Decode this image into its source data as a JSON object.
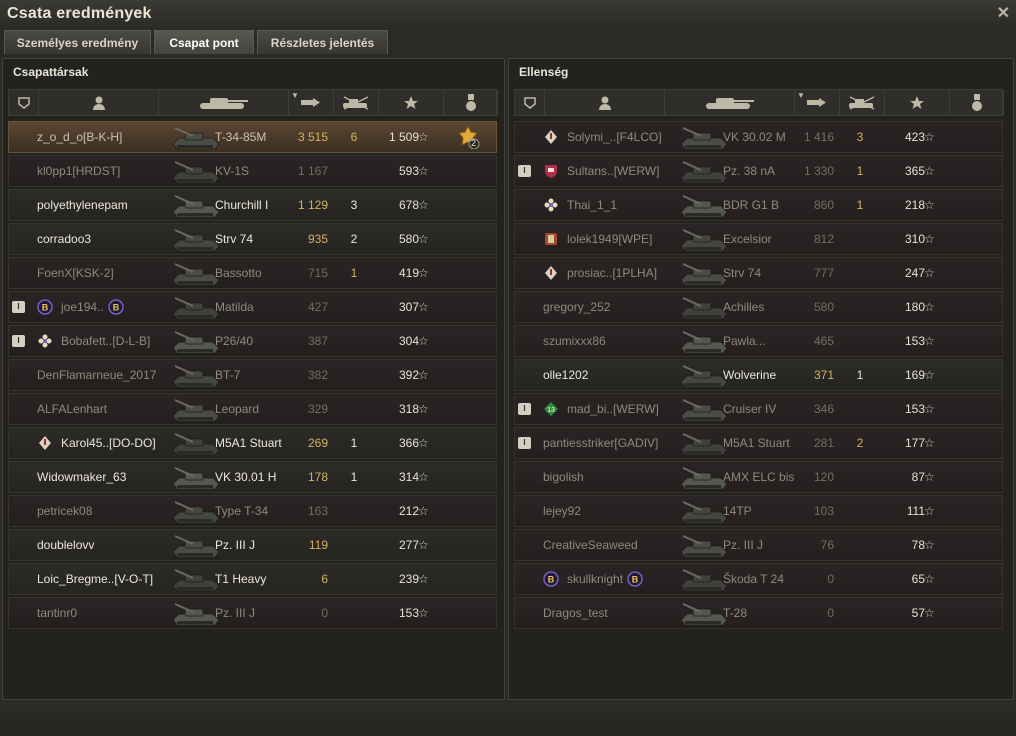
{
  "window": {
    "title": "Csata eredmények",
    "close_icon": "close-icon"
  },
  "tabs": [
    {
      "label": "Személyes eredmény",
      "active": false
    },
    {
      "label": "Csapat pont",
      "active": true
    },
    {
      "label": "Részletes jelentés",
      "active": false
    }
  ],
  "allies": {
    "title": "Csapattársak",
    "players": [
      {
        "name": "z_o_d_o[B-K-H]",
        "tank": "T-34-85M",
        "damage": "3 515",
        "kills": "6",
        "xp": "1 509",
        "state": "sel",
        "medal": {
          "count": "2"
        }
      },
      {
        "name": "kl0pp1[HRDST]",
        "tank": "KV-1S",
        "damage": "1 167",
        "kills": "",
        "xp": "593",
        "state": "dead"
      },
      {
        "name": "polyethylenepam",
        "tank": "Churchill I",
        "damage": "1 129",
        "kills": "3",
        "xp": "678",
        "state": "alive"
      },
      {
        "name": "corradoo3",
        "tank": "Strv 74",
        "damage": "935",
        "kills": "2",
        "xp": "580",
        "state": "alive"
      },
      {
        "name": "FoenX[KSK-2]",
        "tank": "Bassotto",
        "damage": "715",
        "kills": "1",
        "xp": "419",
        "state": "dead"
      },
      {
        "name": "joe194..",
        "tank": "Matilda",
        "damage": "427",
        "kills": "",
        "xp": "307",
        "state": "dead",
        "platoon": true,
        "badge": "b",
        "badge2": "b"
      },
      {
        "name": "Bobafett..[D-L-B]",
        "tank": "P26/40",
        "damage": "387",
        "kills": "",
        "xp": "304",
        "state": "dead",
        "platoon": true,
        "badge": "flower"
      },
      {
        "name": "DenFlamarneue_2017",
        "tank": "BT-7",
        "damage": "382",
        "kills": "",
        "xp": "392",
        "state": "dead"
      },
      {
        "name": "ALFALenhart",
        "tank": "Leopard",
        "damage": "329",
        "kills": "",
        "xp": "318",
        "state": "dead"
      },
      {
        "name": "Karol45..[DO-DO]",
        "tank": "M5A1 Stuart",
        "damage": "269",
        "kills": "1",
        "xp": "366",
        "state": "alive",
        "badge": "diamond"
      },
      {
        "name": "Widowmaker_63",
        "tank": "VK 30.01 H",
        "damage": "178",
        "kills": "1",
        "xp": "314",
        "state": "alive"
      },
      {
        "name": "petricek08",
        "tank": "Type T-34",
        "damage": "163",
        "kills": "",
        "xp": "212",
        "state": "dead"
      },
      {
        "name": "doublelovv",
        "tank": "Pz. III J",
        "damage": "119",
        "kills": "",
        "xp": "277",
        "state": "alive"
      },
      {
        "name": "Loic_Bregme..[V-O-T]",
        "tank": "T1 Heavy",
        "damage": "6",
        "kills": "",
        "xp": "239",
        "state": "alive"
      },
      {
        "name": "tantinr0",
        "tank": "Pz. III J",
        "damage": "0",
        "kills": "",
        "xp": "153",
        "state": "dead"
      }
    ]
  },
  "enemies": {
    "title": "Ellenség",
    "players": [
      {
        "name": "Solymi_..[F4LCO]",
        "tank": "VK 30.02 M",
        "damage": "1 416",
        "kills": "3",
        "xp": "423",
        "state": "dead",
        "badge": "diamond"
      },
      {
        "name": "Sultans..[WERW]",
        "tank": "Pz. 38 nA",
        "damage": "1 330",
        "kills": "1",
        "xp": "365",
        "state": "dead",
        "platoon": true,
        "badge": "shield"
      },
      {
        "name": "Thai_1_1",
        "tank": "BDR G1 B",
        "damage": "860",
        "kills": "1",
        "xp": "218",
        "state": "dead",
        "badge": "flower"
      },
      {
        "name": "lolek1949[WPE]",
        "tank": "Excelsior",
        "damage": "812",
        "kills": "",
        "xp": "310",
        "state": "dead",
        "badge": "crest"
      },
      {
        "name": "prosiac..[1PLHA]",
        "tank": "Strv 74",
        "damage": "777",
        "kills": "",
        "xp": "247",
        "state": "dead",
        "badge": "diamond"
      },
      {
        "name": "gregory_252",
        "tank": "Achilles",
        "damage": "580",
        "kills": "",
        "xp": "180",
        "state": "dead"
      },
      {
        "name": "szumixxx86",
        "tank": "Pawla...",
        "damage": "465",
        "kills": "",
        "xp": "153",
        "state": "dead"
      },
      {
        "name": "olle1202",
        "tank": "Wolverine",
        "damage": "371",
        "kills": "1",
        "xp": "169",
        "state": "alive"
      },
      {
        "name": "mad_bi..[WERW]",
        "tank": "Cruiser IV",
        "damage": "346",
        "kills": "",
        "xp": "153",
        "state": "dead",
        "platoon": true,
        "badge": "green"
      },
      {
        "name": "pantiesstriker[GADIV]",
        "tank": "M5A1 Stuart",
        "damage": "281",
        "kills": "2",
        "xp": "177",
        "state": "dead",
        "platoon": true
      },
      {
        "name": "bigolish",
        "tank": "AMX ELC bis",
        "damage": "120",
        "kills": "",
        "xp": "87",
        "state": "dead"
      },
      {
        "name": "lejey92",
        "tank": "14TP",
        "damage": "103",
        "kills": "",
        "xp": "111",
        "state": "dead"
      },
      {
        "name": "CreativeSeaweed",
        "tank": "Pz. III J",
        "damage": "76",
        "kills": "",
        "xp": "78",
        "state": "dead"
      },
      {
        "name": "skullknight",
        "tank": "Škoda T 24",
        "damage": "0",
        "kills": "",
        "xp": "65",
        "state": "dead",
        "badge": "b",
        "badge2": "b"
      },
      {
        "name": "Dragos_test",
        "tank": "T-28",
        "damage": "0",
        "kills": "",
        "xp": "57",
        "state": "dead"
      }
    ]
  },
  "header_icons": [
    "platoon-icon",
    "player-icon",
    "tank-icon",
    "damage-icon",
    "kills-icon",
    "xp-star-icon",
    "medal-icon"
  ],
  "colors": {
    "accent": "#d7b15e",
    "selected_row": "#5b4632",
    "dead_row": "#2c2424"
  }
}
